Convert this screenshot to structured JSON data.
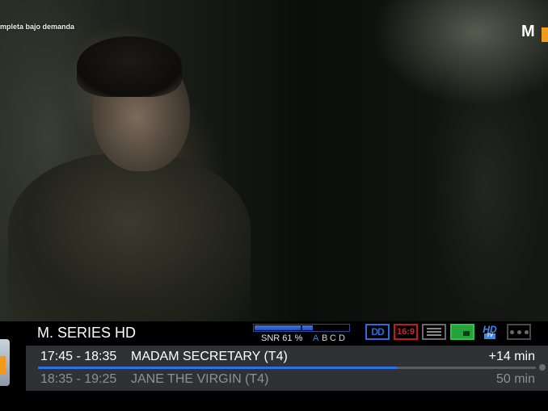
{
  "overlay": {
    "promo_text": "mpleta bajo demanda",
    "channel_logo": "M"
  },
  "infobar": {
    "channel_name": "M. SERIES HD",
    "signal": {
      "snr_label": "SNR 61 %",
      "snr_percent": 61,
      "quality_letters": [
        "A",
        "B",
        "C",
        "D"
      ],
      "active_letter_color": "#3b82f6",
      "inactive_letter_color": "#d8d8d8"
    },
    "status_icons": {
      "dolby_icon": "DD",
      "aspect_icon": "16:9",
      "subtitle_icon": "subtitles-icon",
      "teletext_icon": "teletext-icon",
      "hd_icon": "HD",
      "hd_sub": "TV",
      "record_icon": "cassette-icon"
    },
    "now": {
      "time": "17:45 - 18:35",
      "title": "MADAM SECRETARY (T4)",
      "remaining": "+14 min",
      "progress": 0.72
    },
    "next": {
      "time": "18:35 - 19:25",
      "title": "JANE THE VIRGIN (T4)",
      "duration": "50 min"
    }
  },
  "colors": {
    "accent_blue": "#2c72e6",
    "brand_orange": "#f39a1e",
    "bar_background": "#2f3135"
  }
}
